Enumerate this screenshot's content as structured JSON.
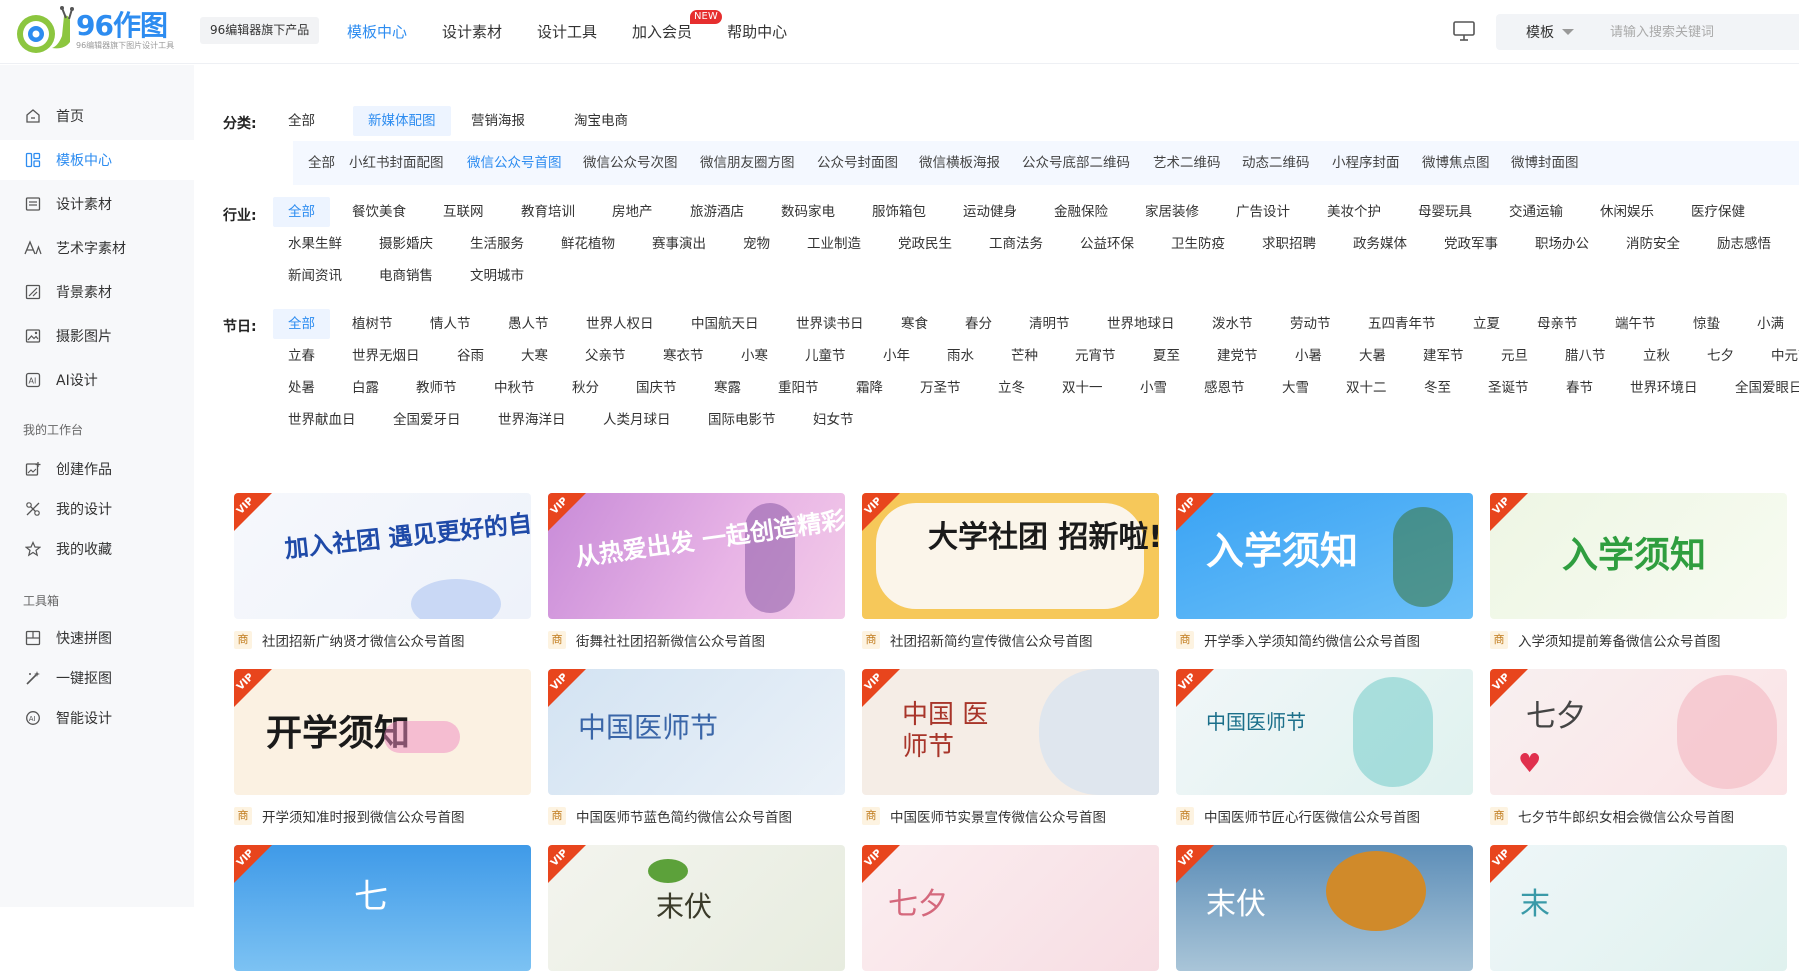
{
  "logo": {
    "main": "96作图",
    "sub": "96编辑器旗下图片设计工具"
  },
  "sub_brand": "96编辑器旗下产品",
  "nav": [
    {
      "label": "模板中心",
      "active": true
    },
    {
      "label": "设计素材"
    },
    {
      "label": "设计工具"
    },
    {
      "label": "加入会员",
      "badge": "NEW"
    },
    {
      "label": "帮助中心"
    }
  ],
  "search": {
    "type": "模板",
    "placeholder": "请输入搜索关键词"
  },
  "sidebar": {
    "items": [
      {
        "label": "首页",
        "icon": "home-icon"
      },
      {
        "label": "模板中心",
        "icon": "template-icon",
        "active": true
      },
      {
        "label": "设计素材",
        "icon": "material-icon"
      },
      {
        "label": "艺术字素材",
        "icon": "font-icon"
      },
      {
        "label": "背景素材",
        "icon": "background-icon"
      },
      {
        "label": "摄影图片",
        "icon": "photo-icon"
      },
      {
        "label": "AI设计",
        "icon": "ai-icon"
      }
    ],
    "workspace_title": "我的工作台",
    "workspace": [
      {
        "label": "创建作品",
        "icon": "create-icon"
      },
      {
        "label": "我的设计",
        "icon": "my-design-icon"
      },
      {
        "label": "我的收藏",
        "icon": "star-icon"
      }
    ],
    "tools_title": "工具箱",
    "tools": [
      {
        "label": "快速拼图",
        "icon": "collage-icon"
      },
      {
        "label": "一键抠图",
        "icon": "cutout-icon"
      },
      {
        "label": "智能设计",
        "icon": "smart-design-icon"
      }
    ]
  },
  "filters": {
    "category_label": "分类:",
    "categories": [
      "全部",
      "新媒体配图",
      "营销海报",
      "淘宝电商"
    ],
    "subcategories": [
      "全部",
      "小红书封面配图",
      "微信公众号首图",
      "微信公众号次图",
      "微信朋友圈方图",
      "公众号封面图",
      "微信横板海报",
      "公众号底部二维码",
      "艺术二维码",
      "动态二维码",
      "小程序封面",
      "微博焦点图",
      "微博封面图"
    ],
    "industry_label": "行业:",
    "industries": [
      [
        "全部",
        "餐饮美食",
        "互联网",
        "教育培训",
        "房地产",
        "旅游酒店",
        "数码家电",
        "服饰箱包",
        "运动健身",
        "金融保险",
        "家居装修",
        "广告设计",
        "美妆个护",
        "母婴玩具",
        "交通运输",
        "休闲娱乐",
        "医疗保健"
      ],
      [
        "水果生鲜",
        "摄影婚庆",
        "生活服务",
        "鲜花植物",
        "赛事演出",
        "宠物",
        "工业制造",
        "党政民生",
        "工商法务",
        "公益环保",
        "卫生防疫",
        "求职招聘",
        "政务媒体",
        "党政军事",
        "职场办公",
        "消防安全",
        "励志感悟"
      ],
      [
        "新闻资讯",
        "电商销售",
        "文明城市"
      ]
    ],
    "festival_label": "节日:",
    "festivals": [
      [
        "全部",
        "植树节",
        "情人节",
        "愚人节",
        "世界人权日",
        "中国航天日",
        "世界读书日",
        "寒食",
        "春分",
        "清明节",
        "世界地球日",
        "泼水节",
        "劳动节",
        "五四青年节",
        "立夏",
        "母亲节",
        "端午节",
        "惊蛰",
        "小满"
      ],
      [
        "立春",
        "世界无烟日",
        "谷雨",
        "大寒",
        "父亲节",
        "寒衣节",
        "小寒",
        "儿童节",
        "小年",
        "雨水",
        "芒种",
        "元宵节",
        "夏至",
        "建党节",
        "小暑",
        "大暑",
        "建军节",
        "元旦",
        "腊八节",
        "立秋",
        "七夕",
        "中元节"
      ],
      [
        "处暑",
        "白露",
        "教师节",
        "中秋节",
        "秋分",
        "国庆节",
        "寒露",
        "重阳节",
        "霜降",
        "万圣节",
        "立冬",
        "双十一",
        "小雪",
        "感恩节",
        "大雪",
        "双十二",
        "冬至",
        "圣诞节",
        "春节",
        "世界环境日",
        "全国爱眼日"
      ],
      [
        "世界献血日",
        "全国爱牙日",
        "世界海洋日",
        "人类月球日",
        "国际电影节",
        "妇女节"
      ]
    ]
  },
  "vip_label": "VIP",
  "shang_label": "商",
  "cards": [
    {
      "title": "社团招新广纳贤才微信公众号首图",
      "image_text": "加入社团 遇见更好的自己"
    },
    {
      "title": "街舞社社团招新微信公众号首图",
      "image_text": "从热爱出发 一起创造精彩"
    },
    {
      "title": "社团招新简约宣传微信公众号首图",
      "image_text": "大学社团 招新啦!"
    },
    {
      "title": "开学季入学须知简约微信公众号首图",
      "image_text": "入学须知"
    },
    {
      "title": "入学须知提前筹备微信公众号首图",
      "image_text": "入学须知"
    },
    {
      "title": "开学须知准时报到微信公众号首图",
      "image_text": "开学须知"
    },
    {
      "title": "中国医师节蓝色简约微信公众号首图",
      "image_text": "中国医师节"
    },
    {
      "title": "中国医师节实景宣传微信公众号首图",
      "image_text": "中国 医师节"
    },
    {
      "title": "中国医师节匠心行医微信公众号首图",
      "image_text": "中国医师节"
    },
    {
      "title": "七夕节牛郎织女相会微信公众号首图",
      "image_text": "七夕"
    },
    {
      "title": "",
      "image_text": "七"
    },
    {
      "title": "",
      "image_text": "末伏"
    },
    {
      "title": "",
      "image_text": "七夕"
    },
    {
      "title": "",
      "image_text": "末伏"
    },
    {
      "title": "",
      "image_text": "末"
    }
  ],
  "colors": {
    "accent": "#2d8cf0",
    "vip": "#e8451d",
    "badge": "#e62e2e"
  }
}
